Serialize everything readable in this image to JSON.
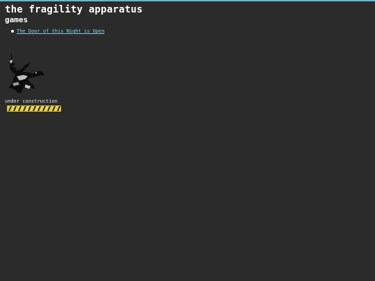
{
  "site": {
    "title": "the fragility apparatus",
    "section_heading": "games"
  },
  "games": [
    {
      "label": "The Door of this Night is Open"
    }
  ],
  "construction": {
    "text": "under construction",
    "banner_colors": [
      "#e7d24a",
      "#1e1e1e"
    ]
  },
  "colors": {
    "background": "#2b2b2b",
    "top_border": "#5fb8d6",
    "link": "#7fd0ea"
  }
}
